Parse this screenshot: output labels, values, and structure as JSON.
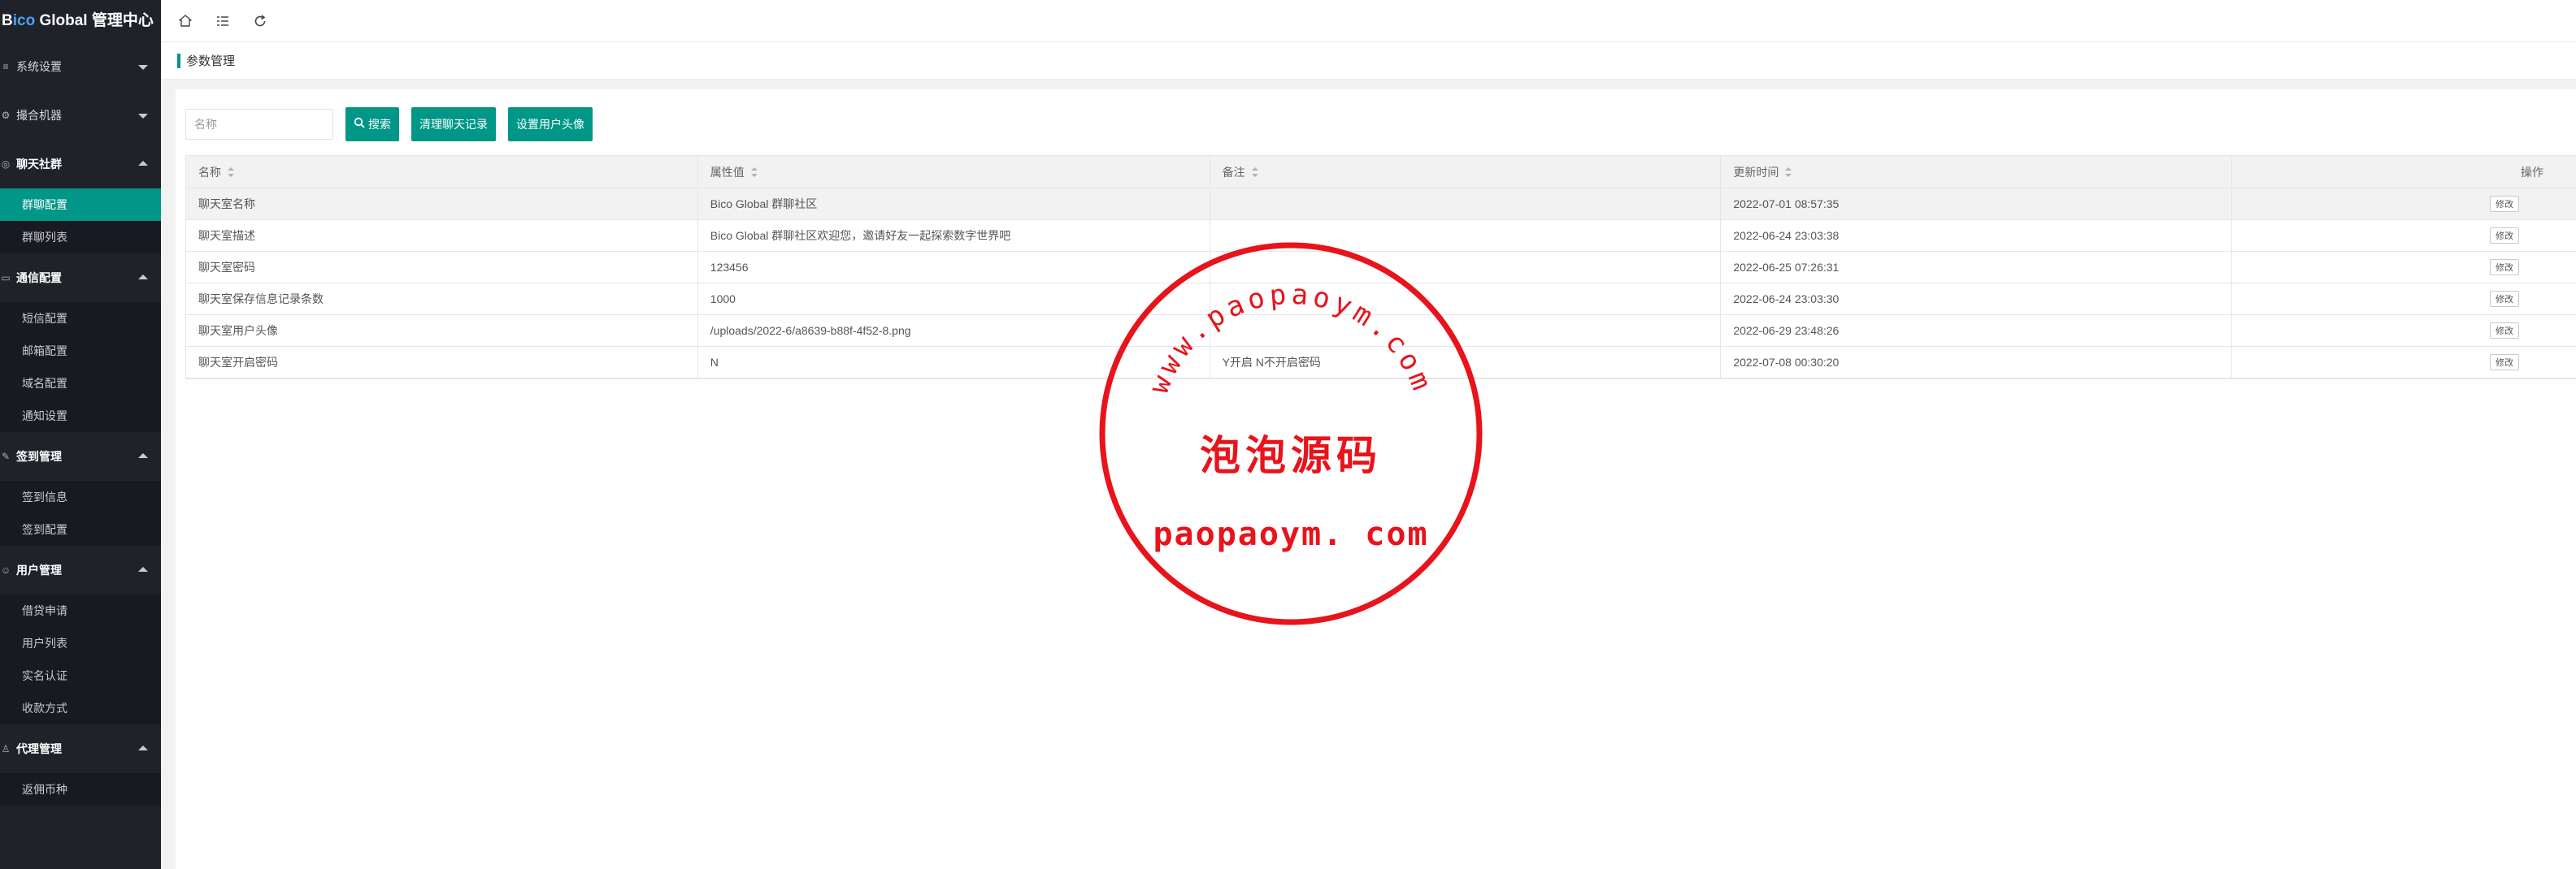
{
  "app": {
    "logo_prefix_b": "B",
    "logo_accent": "ico",
    "logo_rest": " Global 管理中心"
  },
  "sidebar": {
    "groups": [
      {
        "icon": "≡",
        "label": "系统设置",
        "open": false
      },
      {
        "icon": "⚙",
        "label": "撮合机器",
        "open": false
      },
      {
        "icon": "◎",
        "label": "聊天社群",
        "open": true,
        "items": [
          "群聊配置",
          "群聊列表"
        ]
      },
      {
        "icon": "▭",
        "label": "通信配置",
        "open": true,
        "items": [
          "短信配置",
          "邮箱配置",
          "域名配置",
          "通知设置"
        ]
      },
      {
        "icon": "✎",
        "label": "签到管理",
        "open": true,
        "items": [
          "签到信息",
          "签到配置"
        ]
      },
      {
        "icon": "☺",
        "label": "用户管理",
        "open": true,
        "items": [
          "借贷申请",
          "用户列表",
          "实名认证",
          "收款方式"
        ]
      },
      {
        "icon": "♙",
        "label": "代理管理",
        "open": true,
        "items": [
          "返佣币种"
        ]
      }
    ],
    "active_item": "群聊配置"
  },
  "topbar": {
    "home_icon": "home-icon",
    "menu_icon": "list-toggle-icon",
    "refresh_icon": "refresh-icon"
  },
  "breadcrumb": {
    "title": "参数管理"
  },
  "toolbar": {
    "search_placeholder": "名称",
    "search_value": "",
    "search_label": "搜索",
    "clear_label": "清理聊天记录",
    "avatar_label": "设置用户头像"
  },
  "table": {
    "headers": [
      "名称",
      "属性值",
      "备注",
      "更新时间",
      "操作"
    ],
    "rows": [
      [
        "聊天室名称",
        "Bico Global 群聊社区",
        "",
        "2022-07-01 08:57:35"
      ],
      [
        "聊天室描述",
        "Bico Global 群聊社区欢迎您，邀请好友一起探索数字世界吧",
        "",
        "2022-06-24 23:03:38"
      ],
      [
        "聊天室密码",
        "123456",
        "",
        "2022-06-25 07:26:31"
      ],
      [
        "聊天室保存信息记录条数",
        "1000",
        "",
        "2022-06-24 23:03:30"
      ],
      [
        "聊天室用户头像",
        "/uploads/2022-6/a8639-b88f-4f52-8.png",
        "",
        "2022-06-29 23:48:26"
      ],
      [
        "聊天室开启密码",
        "N",
        "Y开启 N不开启密码",
        "2022-07-08 00:30:20"
      ]
    ],
    "action_label": "修改",
    "highlighted_row": 0
  },
  "watermark": {
    "arc_text": "www.paopaoym.com",
    "center_text": "泡泡源码",
    "bottom_text": "paopaoym. com",
    "color": "#e8131b"
  },
  "colors": {
    "accent": "#009688",
    "sidebar_bg": "#20222a",
    "sub_bg": "#191a20"
  }
}
